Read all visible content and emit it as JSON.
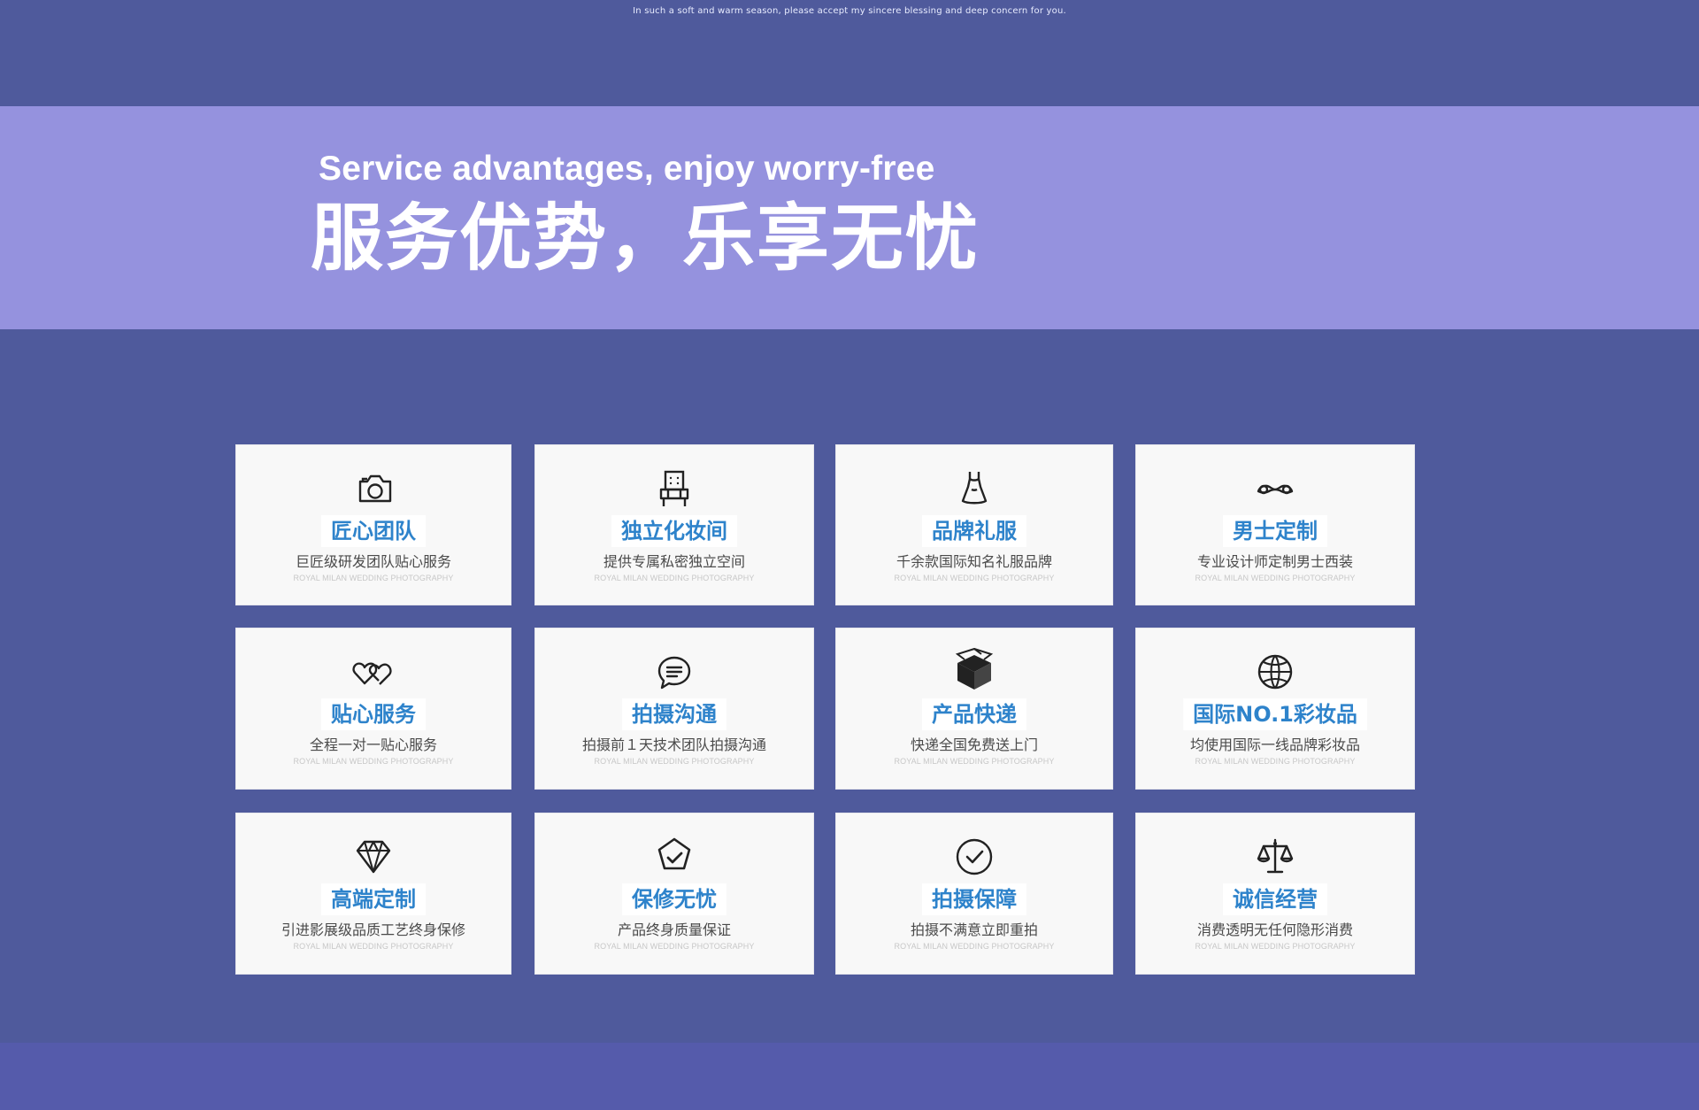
{
  "page": {
    "top_note": "In such a soft and warm season, please accept my sincere blessing and deep concern for you.",
    "banner": {
      "subtitle": "Service advantages, enjoy worry-free",
      "title": "服务优势，乐享无忧"
    },
    "colors": {
      "background": "#4f5a9c",
      "banner": "#9592de",
      "card": "#f8f8f8",
      "title": "#2e83cb",
      "text": "#4a4a4a",
      "footnote": "#c7c7c7"
    }
  },
  "cards": [
    {
      "icon": "camera-icon",
      "title": "匠心团队",
      "description": "巨匠级研发团队贴心服务",
      "footnote": "ROYAL MILAN WEDDING PHOTOGRAPHY"
    },
    {
      "icon": "vanity-mirror-icon",
      "title": "独立化妆间",
      "description": "提供专属私密独立空间",
      "footnote": "ROYAL MILAN WEDDING PHOTOGRAPHY"
    },
    {
      "icon": "dress-icon",
      "title": "品牌礼服",
      "description": "千余款国际知名礼服品牌",
      "footnote": "ROYAL MILAN WEDDING PHOTOGRAPHY"
    },
    {
      "icon": "mustache-icon",
      "title": "男士定制",
      "description": "专业设计师定制男士西装",
      "footnote": "ROYAL MILAN WEDDING PHOTOGRAPHY"
    },
    {
      "icon": "hearts-icon",
      "title": "贴心服务",
      "description": "全程一对一贴心服务",
      "footnote": "ROYAL MILAN WEDDING PHOTOGRAPHY"
    },
    {
      "icon": "chat-icon",
      "title": "拍摄沟通",
      "description": "拍摄前１天技术团队拍摄沟通",
      "footnote": "ROYAL MILAN WEDDING PHOTOGRAPHY"
    },
    {
      "icon": "box-icon",
      "title": "产品快递",
      "description": "快递全国免费送上门",
      "footnote": "ROYAL MILAN WEDDING PHOTOGRAPHY"
    },
    {
      "icon": "globe-icon",
      "title": "国际NO.1彩妆品",
      "description": "均使用国际一线品牌彩妆品",
      "footnote": "ROYAL MILAN WEDDING PHOTOGRAPHY"
    },
    {
      "icon": "diamond-icon",
      "title": "高端定制",
      "description": "引进影展级品质工艺终身保修",
      "footnote": "ROYAL MILAN WEDDING PHOTOGRAPHY"
    },
    {
      "icon": "pentagon-check-icon",
      "title": "保修无忧",
      "description": "产品终身质量保证",
      "footnote": "ROYAL MILAN WEDDING PHOTOGRAPHY"
    },
    {
      "icon": "check-circle-icon",
      "title": "拍摄保障",
      "description": "拍摄不满意立即重拍",
      "footnote": "ROYAL MILAN WEDDING PHOTOGRAPHY"
    },
    {
      "icon": "scale-icon",
      "title": "诚信经营",
      "description": "消费透明无任何隐形消费",
      "footnote": "ROYAL MILAN WEDDING PHOTOGRAPHY"
    }
  ]
}
